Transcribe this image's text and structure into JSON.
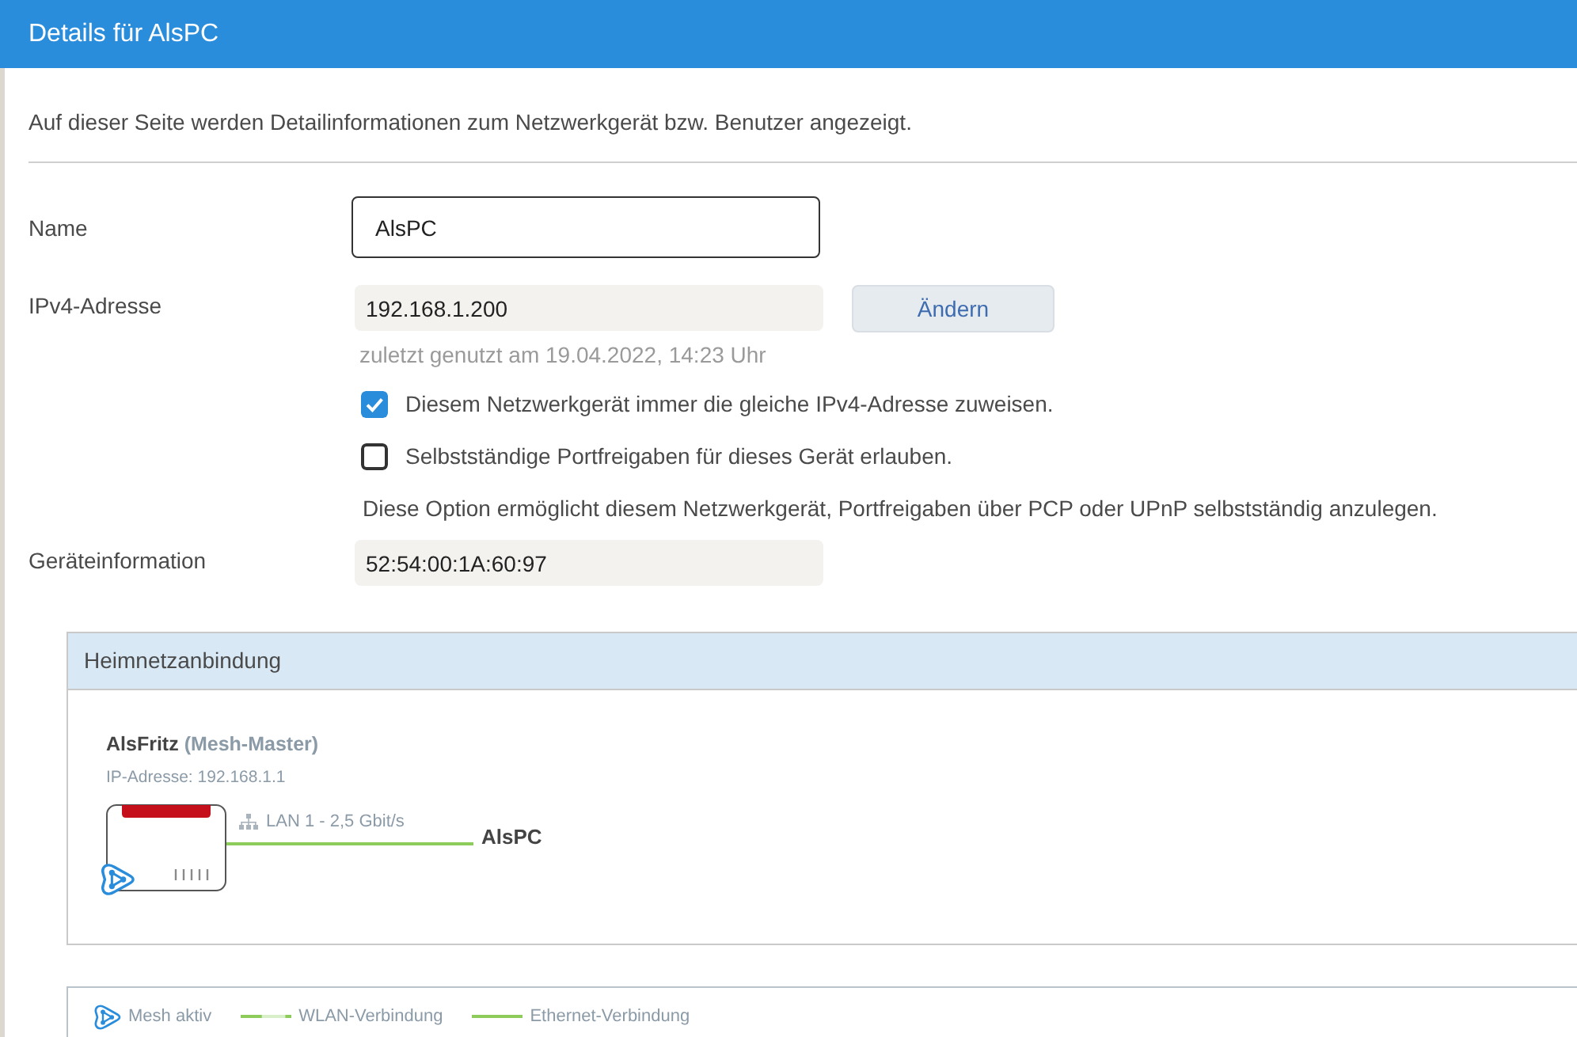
{
  "header": {
    "title": "Details für AlsPC"
  },
  "description": "Auf dieser Seite werden Detailinformationen zum Netzwerkgerät bzw. Benutzer angezeigt.",
  "form": {
    "name": {
      "label": "Name",
      "value": "AlsPC",
      "editable": true
    },
    "ipv4": {
      "label": "IPv4-Adresse",
      "value": "192.168.1.200",
      "editable": false,
      "button": "Ändern",
      "last_used": "zuletzt genutzt am 19.04.2022, 14:23 Uhr"
    },
    "options": [
      {
        "label": "Diesem Netzwerkgerät immer die gleiche IPv4-Adresse zuweisen.",
        "checked": true
      },
      {
        "label": "Selbstständige Portfreigaben für dieses Gerät erlauben.",
        "checked": false
      }
    ],
    "option_hint": "Diese Option ermöglicht diesem Netzwerkgerät, Portfreigaben über PCP oder UPnP selbstständig anzulegen.",
    "device_info": {
      "label": "Geräteinformation",
      "value": "52:54:00:1A:60:97",
      "editable": false
    }
  },
  "connection_panel": {
    "title": "Heimnetzanbindung",
    "router": {
      "name": "AlsFritz",
      "role": "(Mesh-Master)",
      "ip": "IP-Adresse: 192.168.1.1"
    },
    "link": {
      "kind": "ethernet",
      "label": "LAN 1 - 2,5 Gbit/s"
    },
    "device": "AlsPC"
  },
  "legend": [
    {
      "kind": "mesh",
      "label": "Mesh aktiv"
    },
    {
      "kind": "wlan",
      "label": "WLAN-Verbindung"
    },
    {
      "kind": "ethernet",
      "label": "Ethernet-Verbindung"
    }
  ]
}
